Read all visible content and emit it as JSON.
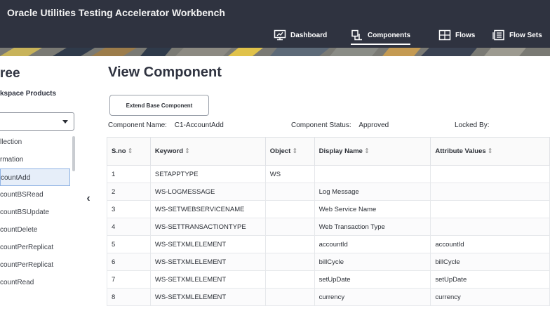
{
  "app": {
    "title": "Oracle Utilities Testing Accelerator Workbench"
  },
  "nav": [
    {
      "label": "Dashboard"
    },
    {
      "label": "Components"
    },
    {
      "label": "Flows"
    },
    {
      "label": "Flow Sets"
    }
  ],
  "tree": {
    "title": "ree",
    "subtitle": "kspace Products",
    "items": [
      "llection",
      "rmation",
      "countAdd",
      "countBSRead",
      "countBSUpdate",
      "countDelete",
      "countPerReplicat",
      "countPerReplicat",
      "countRead"
    ],
    "selected_index": 2
  },
  "collapse_label": "‹",
  "main": {
    "title": "View Component",
    "extend_button": "Extend Base Component",
    "component_name_label": "Component Name:",
    "component_name": "C1-AccountAdd",
    "component_status_label": "Component Status:",
    "component_status": "Approved",
    "locked_by_label": "Locked By:"
  },
  "table": {
    "sort_glyph": "⇕",
    "headers": [
      "S.no",
      "Keyword",
      "Object",
      "Display Name",
      "Attribute Values"
    ],
    "rows": [
      [
        "1",
        "SETAPPTYPE",
        "WS",
        "",
        ""
      ],
      [
        "2",
        "WS-LOGMESSAGE",
        "",
        "Log Message",
        ""
      ],
      [
        "3",
        "WS-SETWEBSERVICENAME",
        "",
        "Web Service Name",
        ""
      ],
      [
        "4",
        "WS-SETTRANSACTIONTYPE",
        "",
        "Web Transaction Type",
        ""
      ],
      [
        "5",
        "WS-SETXMLELEMENT",
        "",
        "accountId",
        "accountId"
      ],
      [
        "6",
        "WS-SETXMLELEMENT",
        "",
        "billCycle",
        "billCycle"
      ],
      [
        "7",
        "WS-SETXMLELEMENT",
        "",
        "setUpDate",
        "setUpDate"
      ],
      [
        "8",
        "WS-SETXMLELEMENT",
        "",
        "currency",
        "currency"
      ]
    ]
  }
}
